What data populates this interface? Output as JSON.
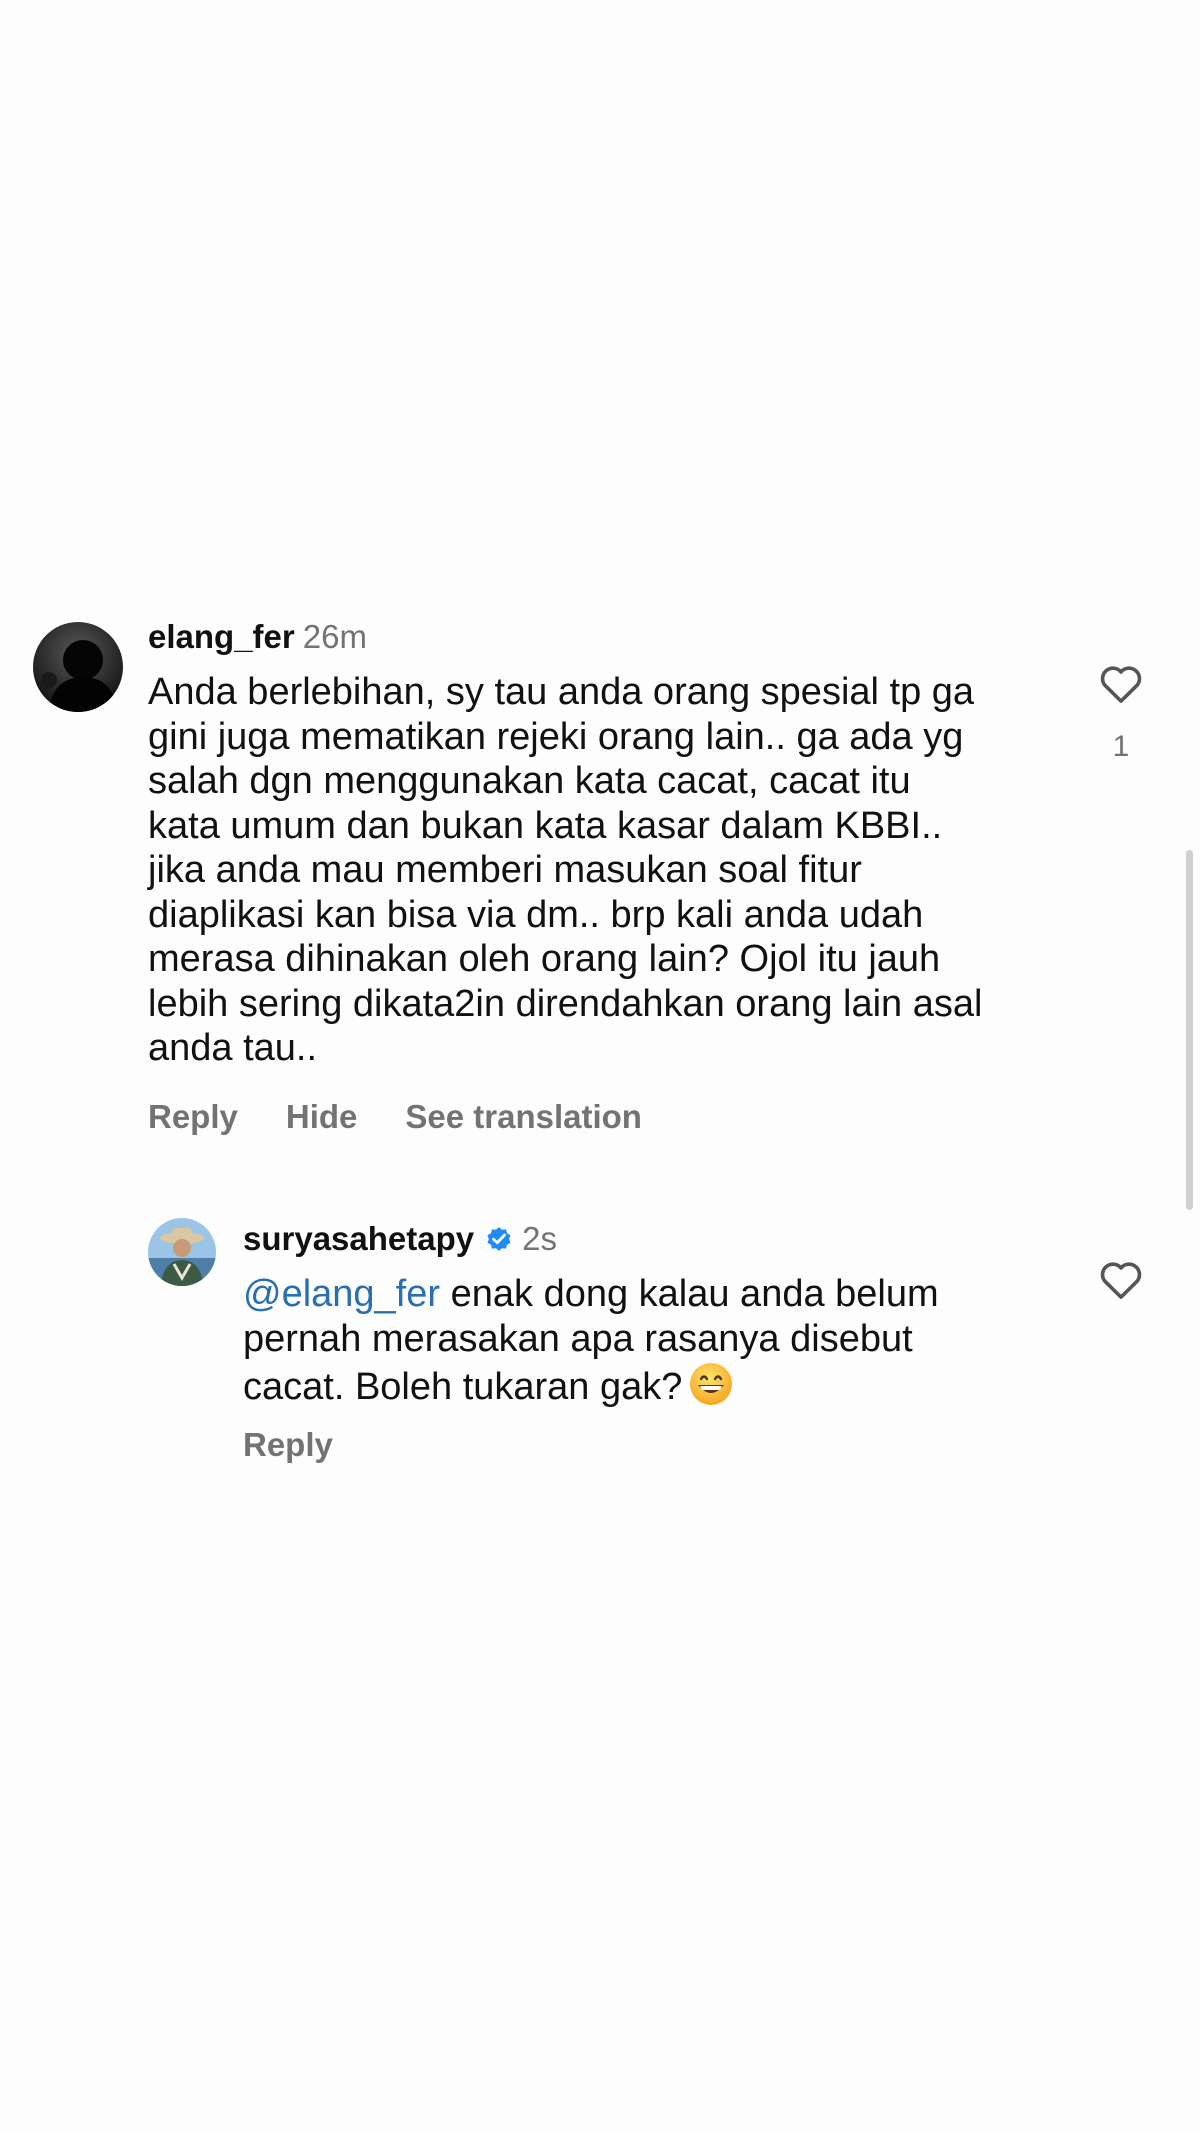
{
  "comments": [
    {
      "username": "elang_fer",
      "time": "26m",
      "lines": [
        "Anda berlebihan, sy tau anda orang spesial tp ga",
        "gini juga mematikan rejeki orang lain.. ga ada yg",
        "salah dgn menggunakan kata cacat, cacat itu",
        "kata umum dan bukan kata kasar dalam KBBI..",
        "jika anda mau memberi masukan soal fitur",
        "diaplikasi kan bisa via dm.. brp kali anda udah",
        "merasa dihinakan oleh orang lain? Ojol itu jauh",
        "lebih sering dikata2in direndahkan orang lain asal",
        "anda tau.."
      ],
      "actions": {
        "reply": "Reply",
        "hide": "Hide",
        "translate": "See translation"
      },
      "like_count": "1",
      "like_icon": "heart-outline-icon"
    }
  ],
  "reply": {
    "username": "suryasahetapy",
    "verified_icon": "verified-badge-icon",
    "time": "2s",
    "mention": "@elang_fer",
    "line1_rest": " enak dong kalau anda belum",
    "line2": "pernah merasakan apa rasanya disebut",
    "line3": "cacat. Boleh tukaran gak?",
    "emoji": "grinning-face-icon",
    "action_reply": "Reply",
    "like_icon": "heart-outline-icon"
  },
  "colors": {
    "accent": "#2a6fb0",
    "muted": "#737373",
    "verified": "#1e8cf0"
  }
}
